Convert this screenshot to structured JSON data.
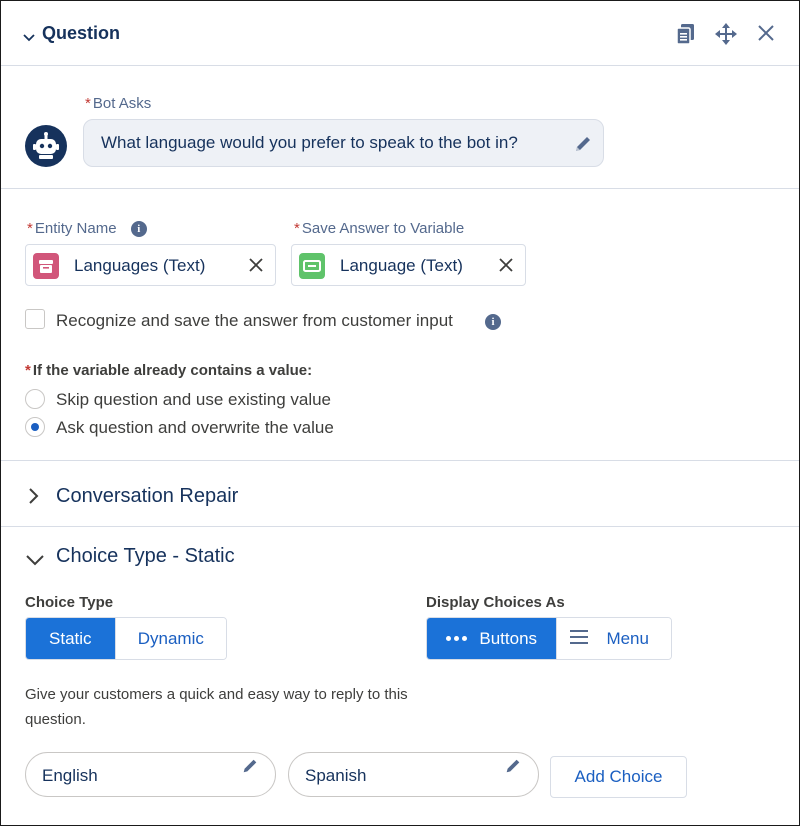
{
  "header": {
    "title": "Question"
  },
  "bot": {
    "label": "Bot Asks",
    "message": "What language would you prefer to speak to the bot in?"
  },
  "entity": {
    "label": "Entity Name",
    "value": "Languages (Text)",
    "icon_color": "#d1567a"
  },
  "variable": {
    "label": "Save Answer to Variable",
    "value": "Language (Text)",
    "icon_color": "#5fc36a"
  },
  "recognize": {
    "label": "Recognize and save the answer from customer input",
    "checked": false
  },
  "existing": {
    "question": "If the variable already contains a value:",
    "options": [
      {
        "label": "Skip question and use existing value",
        "selected": false
      },
      {
        "label": "Ask question and overwrite the value",
        "selected": true
      }
    ]
  },
  "repair": {
    "title": "Conversation Repair"
  },
  "choice": {
    "title": "Choice Type - Static",
    "type_label": "Choice Type",
    "type_options": [
      "Static",
      "Dynamic"
    ],
    "display_label": "Display Choices As",
    "display_options": [
      "Buttons",
      "Menu"
    ],
    "help": "Give your customers a quick and easy way to reply to this question.",
    "choices": [
      "English",
      "Spanish"
    ],
    "add_label": "Add Choice"
  },
  "colors": {
    "accent": "#1b72d8",
    "title": "#16325c",
    "required": "#c23934"
  }
}
